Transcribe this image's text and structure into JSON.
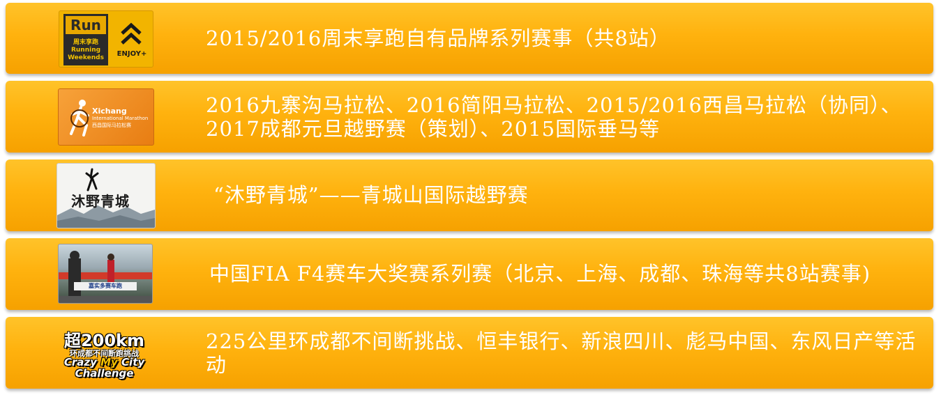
{
  "rows": [
    {
      "text": "2015/2016周末享跑自有品牌系列赛事（共8站）",
      "logo": {
        "name": "running-weekends-logo",
        "run": "Run",
        "line1": "周末享跑",
        "line2": "Running",
        "line3": "Weekends",
        "enjoy": "ENJOY+"
      }
    },
    {
      "text": "2016九寨沟马拉松、2016简阳马拉松、2015/2016西昌马拉松（协同）、2017成都元旦越野赛（策划）、2015国际垂马等",
      "logo": {
        "name": "xichang-marathon-logo",
        "title": "Xichang",
        "sub1": "International Marathon",
        "sub2": "西昌国际马拉松赛"
      }
    },
    {
      "text": "“沐野青城”——青城山国际越野赛",
      "logo": {
        "name": "muye-qingcheng-logo",
        "title": "沐野青城"
      }
    },
    {
      "text": "中国FIA F4赛车大奖赛系列赛（北京、上海、成都、珠海等共8站赛事)",
      "logo": {
        "name": "f4-race-photo",
        "banner": "嘉实多赛车跑"
      }
    },
    {
      "text": "225公里环成都不间断挑战、恒丰银行、新浪四川、彪马中国、东风日产等活动",
      "logo": {
        "name": "crazy-my-city-logo",
        "line1": "超200km",
        "line2": "环成都不间断跑挑战",
        "line3a": "Crazy ",
        "line3b": "My",
        "line3c": " City",
        "line4": "Challenge"
      }
    }
  ]
}
